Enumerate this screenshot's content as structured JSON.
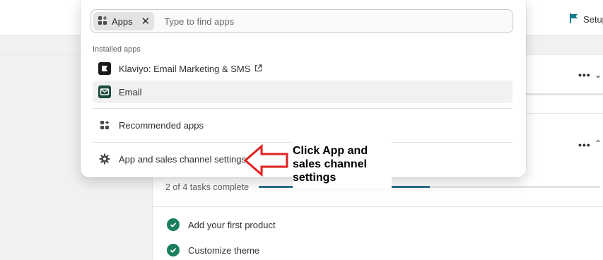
{
  "topbar": {
    "setup_label": "Setup"
  },
  "apps_menu": {
    "chip_label": "Apps",
    "search_placeholder": "Type to find apps",
    "section_label": "Installed apps",
    "installed": [
      {
        "label": "Klaviyo: Email Marketing & SMS",
        "icon": "klaviyo-icon",
        "external": true
      },
      {
        "label": "Email",
        "icon": "email-icon",
        "external": false
      }
    ],
    "recommended_label": "Recommended apps",
    "settings_label": "App and sales channel settings"
  },
  "setup_guide": {
    "progress_text": "2 of 4 tasks complete",
    "progress": 0.5,
    "tasks": [
      {
        "label": "Add your first product",
        "done": true
      },
      {
        "label": "Customize theme",
        "done": true
      }
    ]
  },
  "annotation": {
    "text": "Click App and sales channel settings",
    "color": "#e02020"
  }
}
